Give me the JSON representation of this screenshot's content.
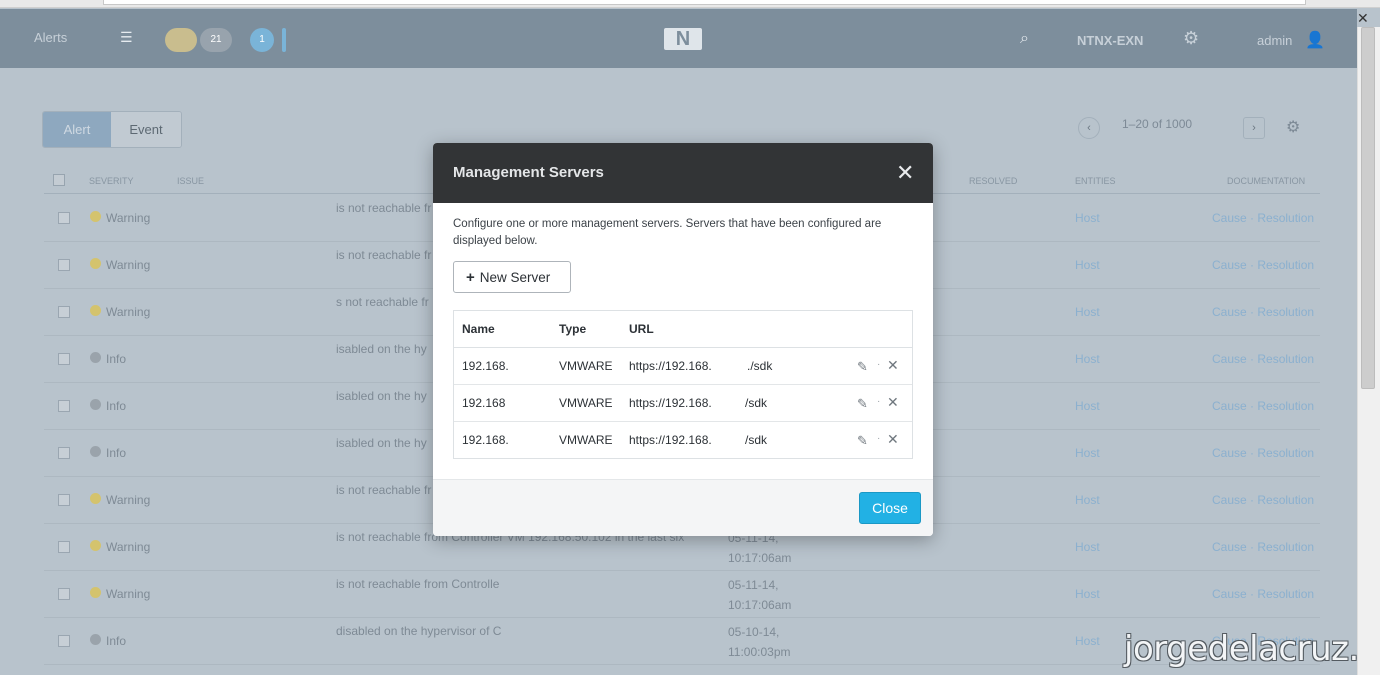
{
  "topbar": {
    "section_title": "Alerts",
    "pill_a": "",
    "pill_b": "21",
    "pill_c": "1",
    "cluster_name": "NTNX-EXN",
    "user": "admin"
  },
  "tabs": [
    {
      "label": "Alert",
      "active": true
    },
    {
      "label": "Event",
      "active": false
    }
  ],
  "pager": {
    "range_text": "1–20 of 1000",
    "prev": "‹",
    "next": "›"
  },
  "table": {
    "columns": [
      "SEVERITY",
      "ISSUE",
      "RESOLVED",
      "ENTITIES",
      "DOCUMENTATION"
    ],
    "rows": [
      {
        "severity": "Warning",
        "issue": "is not reachable fr",
        "when1": "",
        "when2": "",
        "entity": "Host",
        "doc": "Cause · Resolution"
      },
      {
        "severity": "Warning",
        "issue": "is not reachable fr",
        "when1": "",
        "when2": "",
        "entity": "Host",
        "doc": "Cause · Resolution"
      },
      {
        "severity": "Warning",
        "issue": "s not reachable fr",
        "when1": "",
        "when2": "",
        "entity": "Host",
        "doc": "Cause · Resolution"
      },
      {
        "severity": "Info",
        "issue": "isabled on the hy",
        "when1": "",
        "when2": "",
        "entity": "Host",
        "doc": "Cause · Resolution"
      },
      {
        "severity": "Info",
        "issue": "isabled on the hy",
        "when1": "",
        "when2": "",
        "entity": "Host",
        "doc": "Cause · Resolution"
      },
      {
        "severity": "Info",
        "issue": "isabled on the hy",
        "when1": "",
        "when2": "",
        "entity": "Host",
        "doc": "Cause · Resolution"
      },
      {
        "severity": "Warning",
        "issue": "is not reachable fr",
        "when1": "",
        "when2": "",
        "entity": "Host",
        "doc": "Cause · Resolution"
      },
      {
        "severity": "Warning",
        "issue": "is not reachable from Controller VM 192.168.50.102 in the last six",
        "when1": "05-11-14,",
        "when2": "10:17:06am",
        "entity": "Host",
        "doc": "Cause · Resolution"
      },
      {
        "severity": "Warning",
        "issue": "is not reachable from Controlle",
        "when1": "05-11-14,",
        "when2": "10:17:06am",
        "entity": "Host",
        "doc": "Cause · Resolution"
      },
      {
        "severity": "Info",
        "issue": "disabled on the hypervisor of C",
        "when1": "05-10-14,",
        "when2": "11:00:03pm",
        "entity": "Host",
        "doc": "Cause · Resolution"
      }
    ]
  },
  "modal": {
    "title": "Management Servers",
    "description": "Configure one or more management servers. Servers that have been configured are displayed below.",
    "new_server_label": "New Server",
    "columns": {
      "name": "Name",
      "type": "Type",
      "url": "URL"
    },
    "servers": [
      {
        "name": "192.168.",
        "type": "VMWARE",
        "url": "https://192.168.",
        "url_tail": "./sdk"
      },
      {
        "name": "192.168",
        "type": "VMWARE",
        "url": "https://192.168.",
        "url_tail": "/sdk"
      },
      {
        "name": "192.168.",
        "type": "VMWARE",
        "url": "https://192.168.",
        "url_tail": "/sdk"
      }
    ],
    "close_label": "Close"
  },
  "watermark": "jorgedelacruz.es",
  "colors": {
    "accent": "#22b1e4",
    "warning": "#d4c36d",
    "info": "#9aa3ab",
    "header": "#323436"
  }
}
